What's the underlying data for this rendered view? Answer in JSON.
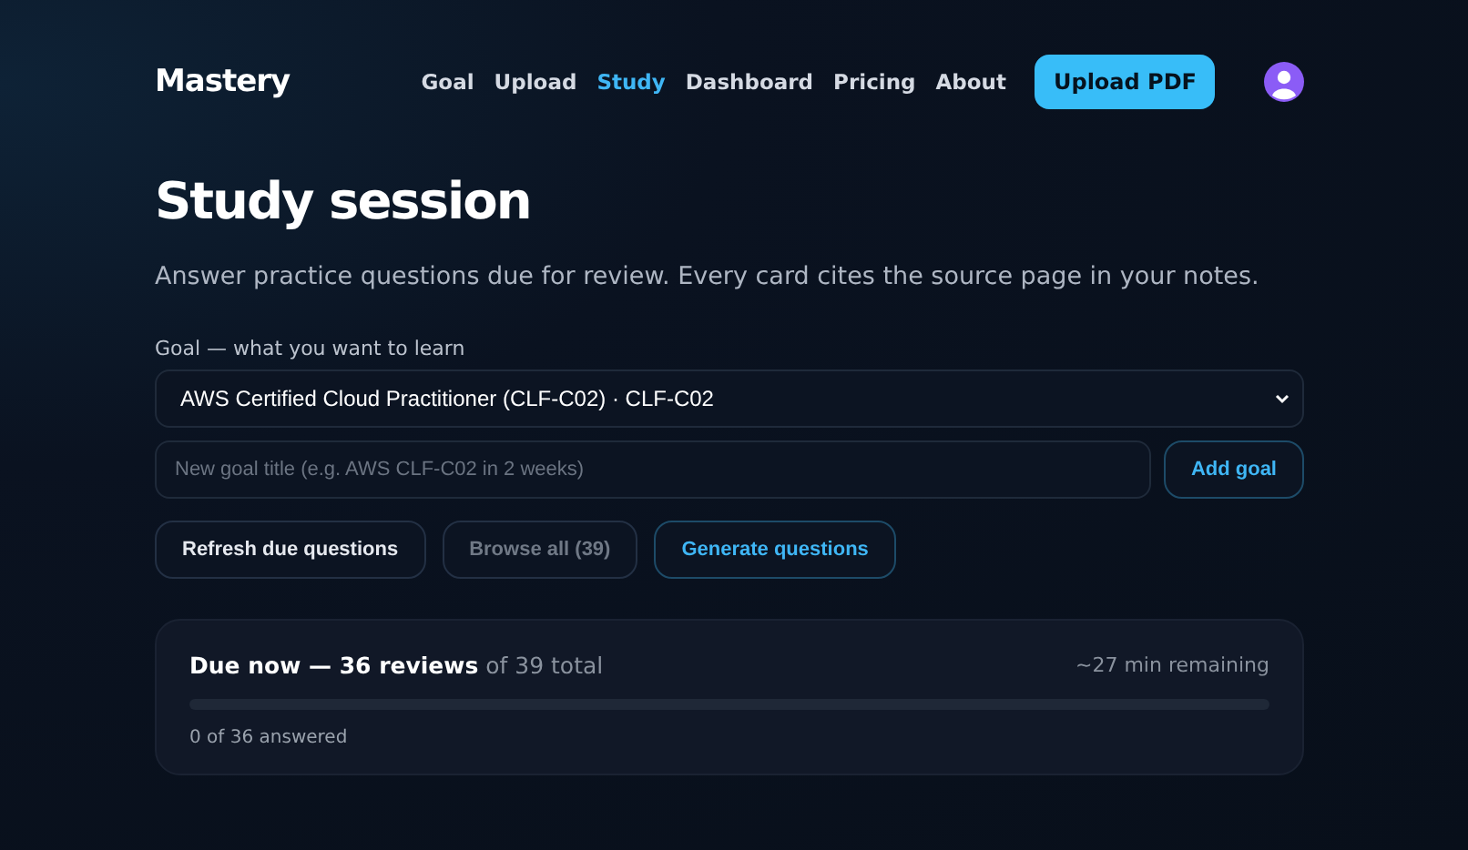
{
  "brand": "Mastery",
  "nav": [
    {
      "label": "Goal",
      "selected": false
    },
    {
      "label": "Upload",
      "selected": false
    },
    {
      "label": "Study",
      "selected": true
    },
    {
      "label": "Dashboard",
      "selected": false
    },
    {
      "label": "Pricing",
      "selected": false
    },
    {
      "label": "About",
      "selected": false
    }
  ],
  "upload_button": "Upload PDF",
  "title": "Study session",
  "subtitle": "Answer practice questions due for review. Every card cites the source page in your notes.",
  "goal_label": "Goal — what you want to learn",
  "goal_select": "AWS Certified Cloud Practitioner (CLF-C02) · CLF-C02",
  "new_goal": {
    "placeholder": "New goal title (e.g. AWS CLF-C02 in 2 weeks)"
  },
  "add_goal_button": "Add goal",
  "actions": [
    {
      "label": "Refresh due questions",
      "kind": "plain",
      "disabled": false
    },
    {
      "label": "Browse all (39)",
      "kind": "plain",
      "disabled": true
    },
    {
      "label": "Generate questions",
      "kind": "accent",
      "disabled": false
    }
  ],
  "due_card": {
    "headline": "**Due now — 36 reviews** of 39 total",
    "remaining": "~27 min remaining",
    "level": 0,
    "answered": "0 of 36 answered"
  }
}
